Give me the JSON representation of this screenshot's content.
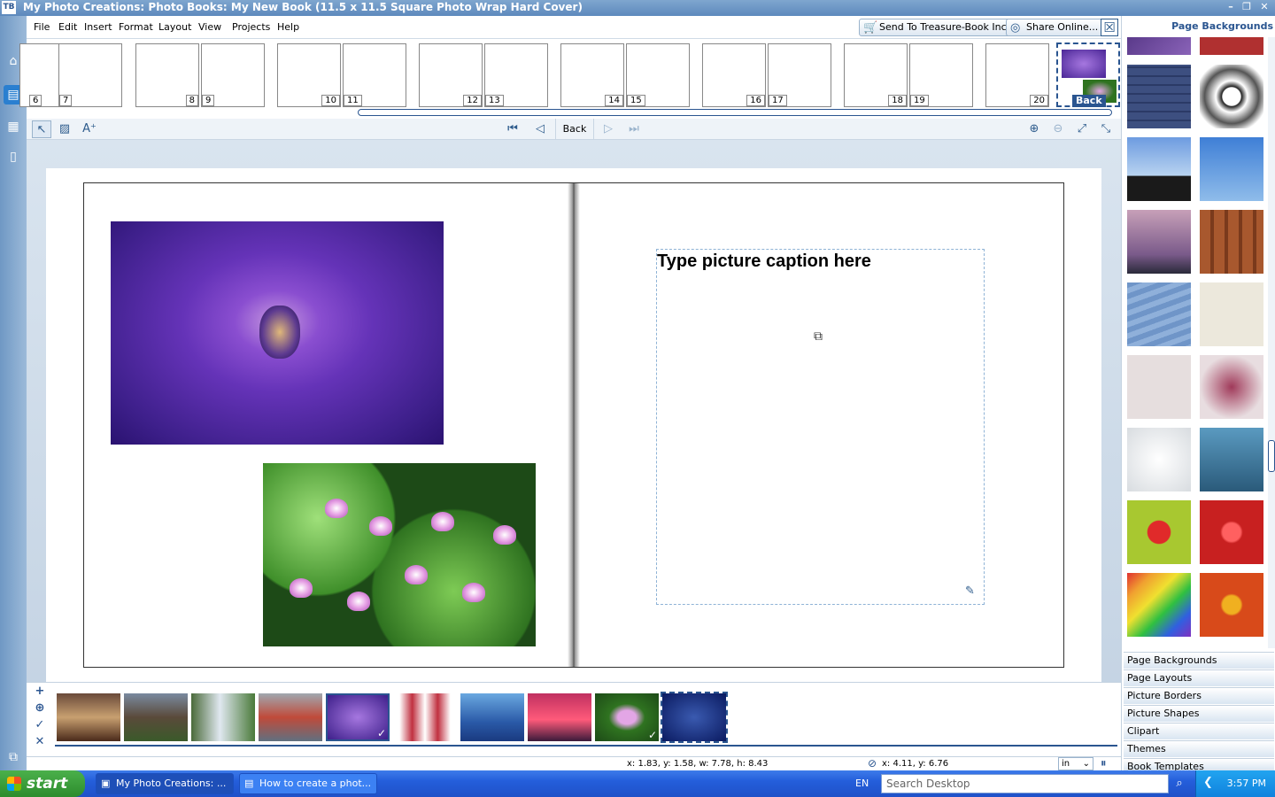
{
  "window": {
    "title": "My Photo Creations: Photo Books: My New Book (11.5 x 11.5 Square Photo Wrap Hard Cover)",
    "app_logo": "TB"
  },
  "menu": [
    "File",
    "Edit",
    "Insert",
    "Format",
    "Layout",
    "View",
    "Projects",
    "Help"
  ],
  "top_buttons": {
    "send": "Send To Treasure-Book Inc",
    "share": "Share Online..."
  },
  "page_thumbs": [
    "6",
    "7",
    "8",
    "9",
    "10",
    "11",
    "12",
    "13",
    "14",
    "15",
    "16",
    "17",
    "18",
    "19",
    "20"
  ],
  "back_thumb_label": "Back",
  "toolbar": {
    "back_label": "Back"
  },
  "caption": {
    "placeholder": "Type picture caption here"
  },
  "right_panel": {
    "title": "Page Backgrounds",
    "categories": [
      "Page Backgrounds",
      "Page Layouts",
      "Picture Borders",
      "Picture Shapes",
      "Clipart",
      "Themes",
      "Book Templates"
    ]
  },
  "status": {
    "selection": "x: 1.83, y: 1.58, w: 7.78, h: 8.43",
    "cursor": "x: 4.11, y: 6.76",
    "units": "in"
  },
  "taskbar": {
    "start": "start",
    "items": [
      "My Photo Creations: ...",
      "How to create a phot..."
    ],
    "language": "EN",
    "search_placeholder": "Search Desktop",
    "clock": "3:57 PM"
  },
  "colors": {
    "accent": "#2a5590",
    "titlebar": "#5d89bd",
    "taskbar": "#245edb"
  }
}
